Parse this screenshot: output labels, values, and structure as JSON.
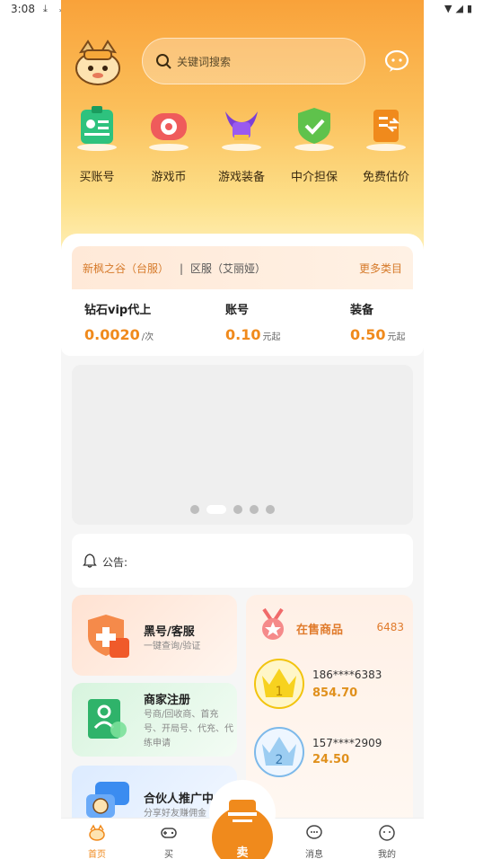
{
  "status_bar": {
    "time": "3:08"
  },
  "header": {
    "search_placeholder": "关键词搜索"
  },
  "categories": [
    {
      "label": "买账号",
      "icon": "id-card-icon"
    },
    {
      "label": "游戏币",
      "icon": "game-coin-icon"
    },
    {
      "label": "游戏装备",
      "icon": "helmet-icon"
    },
    {
      "label": "中介担保",
      "icon": "shield-check-icon"
    },
    {
      "label": "免费估价",
      "icon": "valuation-icon"
    }
  ],
  "region": {
    "server": "新枫之谷（台服）",
    "separator": "|",
    "zone": "区服（艾丽娅）",
    "more": "更多类目",
    "items": [
      {
        "title": "钻石vip代上",
        "price": "0.0020",
        "unit": "/次"
      },
      {
        "title": "账号",
        "price": "0.10",
        "unit": "元起"
      },
      {
        "title": "装备",
        "price": "0.50",
        "unit": "元起"
      }
    ]
  },
  "banner": {
    "active_index": 1,
    "dots": 5
  },
  "notice": {
    "label": "公告:"
  },
  "services": [
    {
      "title": "黑号/客服",
      "sub": "一键查询/验证"
    },
    {
      "title": "商家注册",
      "sub": "号商/回收商、首充号、开局号、代充、代练申请"
    },
    {
      "title": "合伙人推广中",
      "sub": "分享好友赚佣金"
    }
  ],
  "on_sale": {
    "title": "在售商品",
    "count": "6483",
    "ranks": [
      {
        "rank": "1",
        "phone": "186****6383",
        "price": "854.70"
      },
      {
        "rank": "2",
        "phone": "157****2909",
        "price": "24.50"
      }
    ]
  },
  "nav": {
    "home": "首页",
    "buy": "买",
    "sell": "卖",
    "messages": "消息",
    "mine": "我的"
  },
  "colors": {
    "accent": "#f08a1c",
    "hero_top": "#f9a23a"
  }
}
